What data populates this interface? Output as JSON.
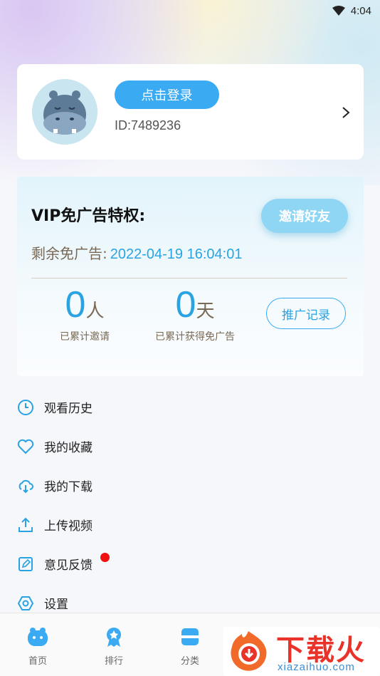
{
  "status_bar": {
    "time": "4:04"
  },
  "profile": {
    "login_label": "点击登录",
    "user_id": "ID:7489236"
  },
  "vip": {
    "title": "VIP免广告特权:",
    "invite_label": "邀请好友",
    "remain_label": "剩余免广告:",
    "remain_value": "2022-04-19 16:04:01",
    "invited_count": "0",
    "invited_unit": "人",
    "invited_label": "已累计邀请",
    "days_count": "0",
    "days_unit": "天",
    "days_label": "已累计获得免广告",
    "record_label": "推广记录"
  },
  "menu": {
    "items": [
      {
        "label": "观看历史",
        "icon": "clock-icon"
      },
      {
        "label": "我的收藏",
        "icon": "heart-icon"
      },
      {
        "label": "我的下载",
        "icon": "cloud-download-icon"
      },
      {
        "label": "上传视频",
        "icon": "upload-icon"
      },
      {
        "label": "意见反馈",
        "icon": "edit-icon"
      },
      {
        "label": "设置",
        "icon": "settings-icon"
      }
    ]
  },
  "tabbar": {
    "tabs": [
      {
        "label": "首页",
        "icon": "hippo-home-icon"
      },
      {
        "label": "排行",
        "icon": "award-icon"
      },
      {
        "label": "分类",
        "icon": "category-icon"
      }
    ]
  },
  "watermark": {
    "title": "下载火",
    "url": "xiazaihuo.com"
  },
  "colors": {
    "accent": "#3aaaf3",
    "accent_text": "#2aa3e2",
    "muted_text": "#7a6a55",
    "badge": "#f01010"
  }
}
